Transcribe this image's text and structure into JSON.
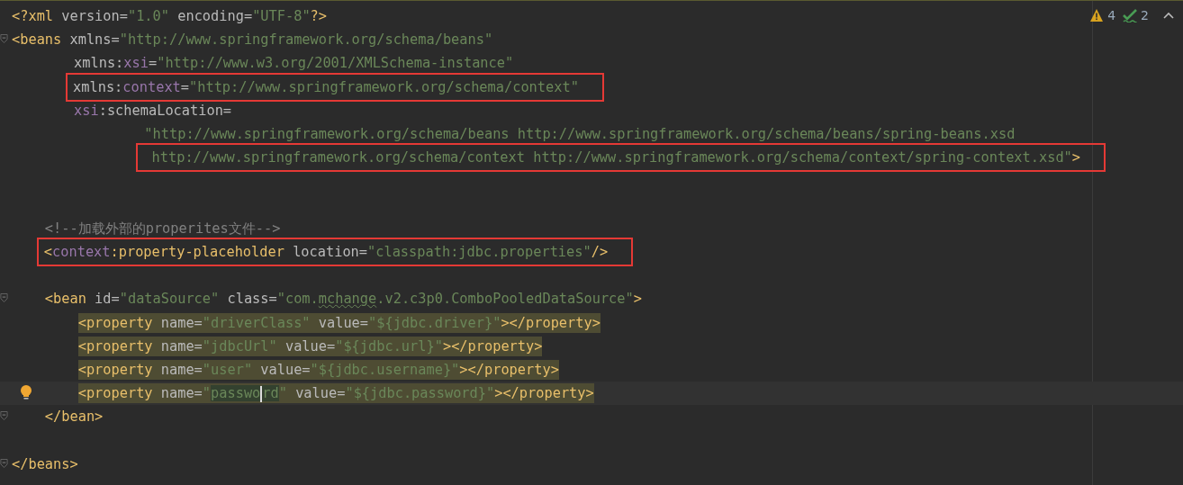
{
  "inspections": [
    {
      "kind": "warning",
      "count": "4"
    },
    {
      "kind": "weak",
      "count": "2"
    }
  ],
  "lines": [
    {
      "kind": "code",
      "tokens": [
        {
          "kind": "tag",
          "text": "<?xml"
        },
        {
          "kind": "attr",
          "text": " version="
        },
        {
          "kind": "value",
          "text": "\"1.0\""
        },
        {
          "kind": "attr",
          "text": " encoding="
        },
        {
          "kind": "value",
          "text": "\"UTF-8\""
        },
        {
          "kind": "tag",
          "text": "?>"
        }
      ]
    },
    {
      "kind": "code",
      "fold": true,
      "tokens": [
        {
          "kind": "tag",
          "text": "<beans"
        },
        {
          "kind": "attr",
          "text": " xmlns="
        },
        {
          "kind": "value",
          "text": "\"http://www.springframework.org/schema/beans\""
        }
      ],
      "continuation": [
        {
          "kind": "attribute",
          "tokens": [
            {
              "kind": "attr",
              "text": "xmlns:"
            },
            {
              "kind": "ns",
              "text": "xsi"
            },
            {
              "kind": "attr",
              "text": "="
            },
            {
              "kind": "value",
              "text": "\"http://www.w3.org/2001/XMLSchema-instance\""
            }
          ]
        },
        {
          "kind": "attribute",
          "boxed": true,
          "tokens": [
            {
              "kind": "attr",
              "text": "xmlns:"
            },
            {
              "kind": "ns",
              "text": "context"
            },
            {
              "kind": "attr",
              "text": "="
            },
            {
              "kind": "value",
              "text": "\"http://www.springframework.org/schema/context\""
            }
          ]
        },
        {
          "kind": "attribute",
          "tokens": [
            {
              "kind": "ns",
              "text": "xsi"
            },
            {
              "kind": "attr",
              "text": ":schemaLocation="
            }
          ]
        },
        {
          "kind": "value",
          "tokens": [
            {
              "kind": "value",
              "text": "\"http://www.springframework.org/schema/beans http://www.springframework.org/schema/beans/spring-beans.xsd"
            }
          ]
        },
        {
          "kind": "value",
          "boxed": true,
          "tokens": [
            {
              "kind": "value",
              "text": " http://www.springframework.org/schema/context http://www.springframework.org/schema/context/spring-context.xsd\""
            },
            {
              "kind": "tag",
              "text": ">"
            }
          ]
        }
      ],
      "children": [
        {
          "kind": "blank"
        },
        {
          "kind": "blank"
        },
        {
          "kind": "code",
          "tokens": [
            {
              "kind": "comment",
              "text": "<!--加载外部的properites文件-->"
            }
          ]
        },
        {
          "kind": "code",
          "boxed": true,
          "tokens": [
            {
              "kind": "tag",
              "text": "<"
            },
            {
              "kind": "ns",
              "text": "context"
            },
            {
              "kind": "tag",
              "text": ":property-placeholder"
            },
            {
              "kind": "attr",
              "text": " location="
            },
            {
              "kind": "value",
              "text": "\"classpath:jdbc.properties\""
            },
            {
              "kind": "tag",
              "text": "/>"
            }
          ]
        },
        {
          "kind": "blank"
        },
        {
          "kind": "code",
          "fold": true,
          "tokens": [
            {
              "kind": "tag",
              "text": "<bean"
            },
            {
              "kind": "attr",
              "text": " id="
            },
            {
              "kind": "value",
              "text": "\"dataSource\""
            },
            {
              "kind": "attr",
              "text": " class="
            },
            {
              "kind": "value",
              "text": "\"com."
            },
            {
              "kind": "value",
              "text": "mchange",
              "typo": true
            },
            {
              "kind": "value",
              "text": ".v2.c3p0.ComboPooledDataSource\""
            },
            {
              "kind": "tag",
              "text": ">"
            }
          ],
          "children": [
            {
              "kind": "code",
              "highlighted": true,
              "tokens": [
                {
                  "kind": "tag",
                  "text": "<property"
                },
                {
                  "kind": "attr",
                  "text": " name="
                },
                {
                  "kind": "value",
                  "text": "\"driverClass\""
                },
                {
                  "kind": "attr",
                  "text": " value="
                },
                {
                  "kind": "value",
                  "text": "\"${jdbc.driver}\""
                },
                {
                  "kind": "tag",
                  "text": "></property>"
                }
              ]
            },
            {
              "kind": "code",
              "highlighted": true,
              "tokens": [
                {
                  "kind": "tag",
                  "text": "<property"
                },
                {
                  "kind": "attr",
                  "text": " name="
                },
                {
                  "kind": "value",
                  "text": "\"jdbcUrl\""
                },
                {
                  "kind": "attr",
                  "text": " value="
                },
                {
                  "kind": "value",
                  "text": "\"${jdbc.url}\""
                },
                {
                  "kind": "tag",
                  "text": "></property>"
                }
              ]
            },
            {
              "kind": "code",
              "highlighted": true,
              "tokens": [
                {
                  "kind": "tag",
                  "text": "<property"
                },
                {
                  "kind": "attr",
                  "text": " name="
                },
                {
                  "kind": "value",
                  "text": "\"user\""
                },
                {
                  "kind": "attr",
                  "text": " value="
                },
                {
                  "kind": "value",
                  "text": "\"${jdbc.username}\""
                },
                {
                  "kind": "tag",
                  "text": "></property>"
                }
              ]
            },
            {
              "kind": "code",
              "highlighted": true,
              "current": true,
              "tokens": [
                {
                  "kind": "tag",
                  "text": "<property"
                },
                {
                  "kind": "attr",
                  "text": " name="
                },
                {
                  "kind": "value",
                  "text": "\""
                },
                {
                  "kind": "value",
                  "text": "passwo",
                  "found": true,
                  "caret": true
                },
                {
                  "kind": "value",
                  "text": "rd",
                  "found": true
                },
                {
                  "kind": "value",
                  "text": "\""
                },
                {
                  "kind": "attr",
                  "text": " value="
                },
                {
                  "kind": "value",
                  "text": "\"${jdbc.password}\""
                },
                {
                  "kind": "tag",
                  "text": "></property>"
                }
              ]
            }
          ]
        },
        {
          "kind": "code",
          "fold": true,
          "tokens": [
            {
              "kind": "tag",
              "text": "</bean>"
            }
          ]
        },
        {
          "kind": "blank"
        }
      ]
    },
    {
      "kind": "code",
      "fold": true,
      "tokens": [
        {
          "kind": "tag",
          "text": "</beans>"
        }
      ]
    }
  ]
}
